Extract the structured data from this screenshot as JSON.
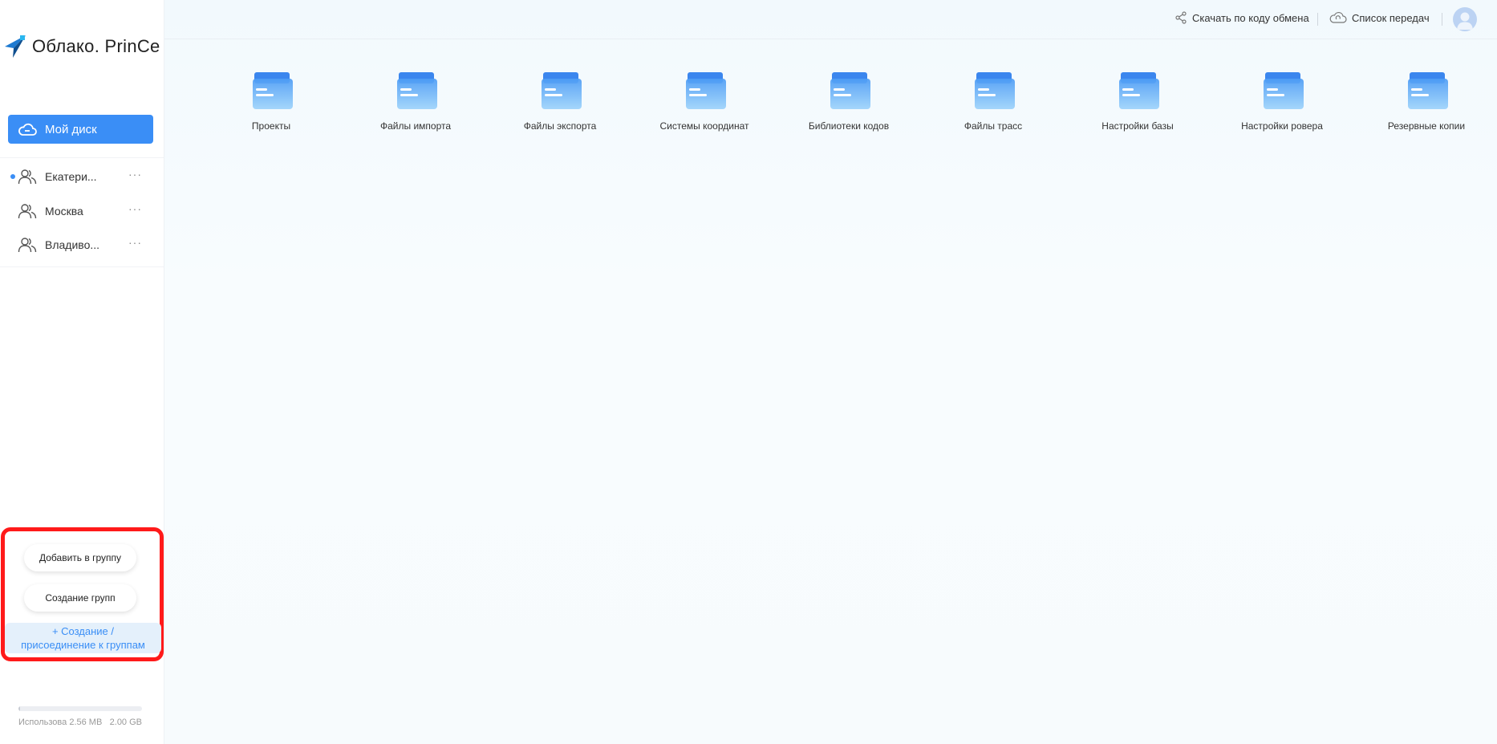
{
  "app": {
    "logo_text": "Облако. PrinCe"
  },
  "sidebar": {
    "my_disk_label": "Мой диск",
    "groups": [
      {
        "name": "Екатери...",
        "more": "···",
        "active": true
      },
      {
        "name": "Москва",
        "more": "···",
        "active": false
      },
      {
        "name": "Владиво...",
        "more": "···",
        "active": false
      }
    ],
    "add_to_group_label": "Добавить в группу",
    "create_groups_label": "Создание групп",
    "join_groups_label": "+ Создание /\nприсоединение к группам",
    "storage": {
      "used_text": "Использова 2.56 MB",
      "total_text": "2.00 GB",
      "used_fraction": 0.0013
    }
  },
  "header": {
    "share_code_label": "Скачать по коду обмена",
    "transfers_label": "Список передач"
  },
  "folders": [
    {
      "name": "Проекты"
    },
    {
      "name": "Файлы импорта"
    },
    {
      "name": "Файлы экспорта"
    },
    {
      "name": "Системы координат"
    },
    {
      "name": "Библиотеки кодов"
    },
    {
      "name": "Файлы трасс"
    },
    {
      "name": "Настройки базы"
    },
    {
      "name": "Настройки ровера"
    },
    {
      "name": "Резервные копии"
    }
  ],
  "colors": {
    "accent": "#3a8ef6",
    "highlight": "#ff1a1a"
  }
}
